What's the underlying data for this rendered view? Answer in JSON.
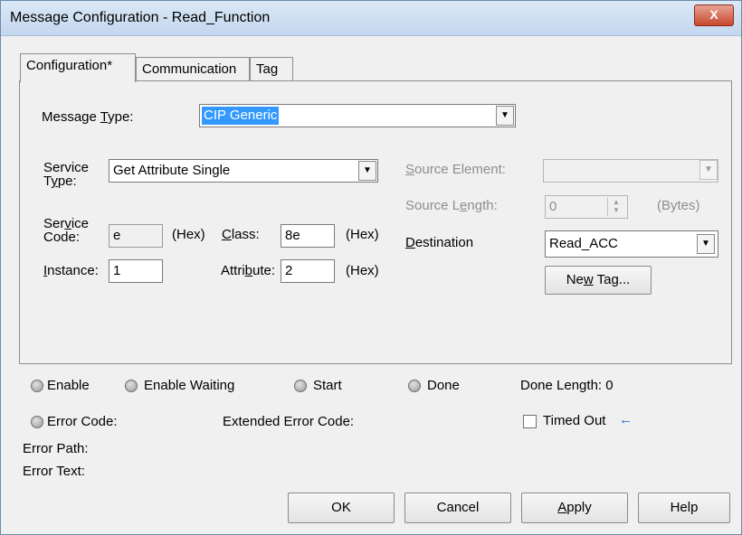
{
  "window": {
    "title": "Message Configuration - Read_Function",
    "close_label": "X"
  },
  "tabs": [
    {
      "label": "Configuration*"
    },
    {
      "label": "Communication"
    },
    {
      "label": "Tag"
    }
  ],
  "config": {
    "message_type_label": "Message Type:",
    "message_type_value": "CIP Generic",
    "service_type_label": "Service Type:",
    "service_type_value": "Get Attribute Single",
    "service_code_label": "Service Code:",
    "service_code_value": "e",
    "hex_label": "(Hex)",
    "class_label": "Class:",
    "class_value": "8e",
    "instance_label": "Instance:",
    "instance_value": "1",
    "attribute_label": "Attribute:",
    "attribute_value": "2",
    "source_element_label": "Source Element:",
    "source_element_value": "",
    "source_length_label": "Source Length:",
    "source_length_value": "0",
    "bytes_label": "(Bytes)",
    "destination_label": "Destination",
    "destination_value": "Read_ACC",
    "new_tag_label": "New Tag..."
  },
  "status": {
    "enable": "Enable",
    "enable_waiting": "Enable Waiting",
    "start": "Start",
    "done": "Done",
    "done_length": "Done Length: 0",
    "error_code": "Error Code:",
    "extended_error_code": "Extended Error Code:",
    "timed_out": "Timed Out",
    "timed_out_arrow": "←",
    "error_path": "Error Path:",
    "error_text": "Error Text:"
  },
  "buttons": {
    "ok": "OK",
    "cancel": "Cancel",
    "apply": "Apply",
    "help": "Help"
  }
}
